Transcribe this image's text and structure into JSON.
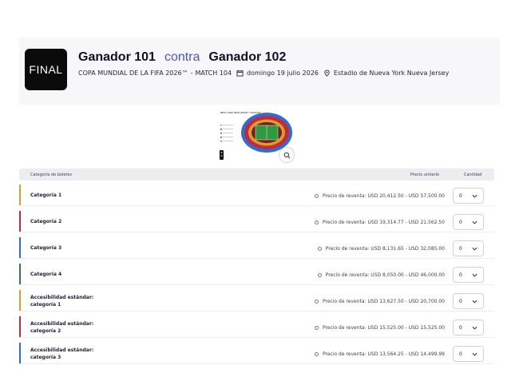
{
  "match": {
    "badge": "FINAL",
    "team_a": "Ganador 101",
    "vs": "contra",
    "team_b": "Ganador 102",
    "competition": "COPA MUNDIAL DE LA FIFA 2026™",
    "separator": "-",
    "match_no": "MATCH 104",
    "date": "domingo 19 julio 2026",
    "venue": "Estadio de Nueva York Nueva Jersey"
  },
  "map": {
    "stadium_label": "NEW YORK NEW JERSEY STADIUM"
  },
  "table": {
    "col_category": "Categoría de boletos",
    "col_unit_price": "Precio unitario",
    "col_quantity": "Cantidad"
  },
  "rows": [
    {
      "line1": "Categoría 1",
      "line2": "",
      "color": "#d4a02a",
      "price": "Precio de reventa: USD 20,412.50  -  USD 57,500.00",
      "qty": "0"
    },
    {
      "line1": "Categoría 2",
      "line2": "",
      "color": "#c7283a",
      "price": "Precio de reventa: USD 19,314.77  -  USD 21,562.50",
      "qty": "0"
    },
    {
      "line1": "Categoría 3",
      "line2": "",
      "color": "#2b6fd6",
      "price": "Precio de reventa: USD 8,131.65  -  USD 32,085.00",
      "qty": "0"
    },
    {
      "line1": "Categoría 4",
      "line2": "",
      "color": "#2f7d3f",
      "price": "Precio de reventa: USD 8,050.00  -  USD 46,000.00",
      "qty": "0"
    },
    {
      "line1": "Accesibilidad estándar:",
      "line2": "categoría 1",
      "color": "#d4a02a",
      "price": "Precio de reventa: USD 13,627.50  -  USD 20,700.00",
      "qty": "0"
    },
    {
      "line1": "Accesibilidad estándar:",
      "line2": "categoría 2",
      "color": "#c7283a",
      "price": "Precio de reventa: USD 15,525.00  -  USD 15,525.00",
      "qty": "0"
    },
    {
      "line1": "Accesibilidad estándar:",
      "line2": "categoría 3",
      "color": "#2b6fd6",
      "price": "Precio de reventa: USD 13,564.25  -  USD 14,499.99",
      "qty": "0"
    }
  ]
}
